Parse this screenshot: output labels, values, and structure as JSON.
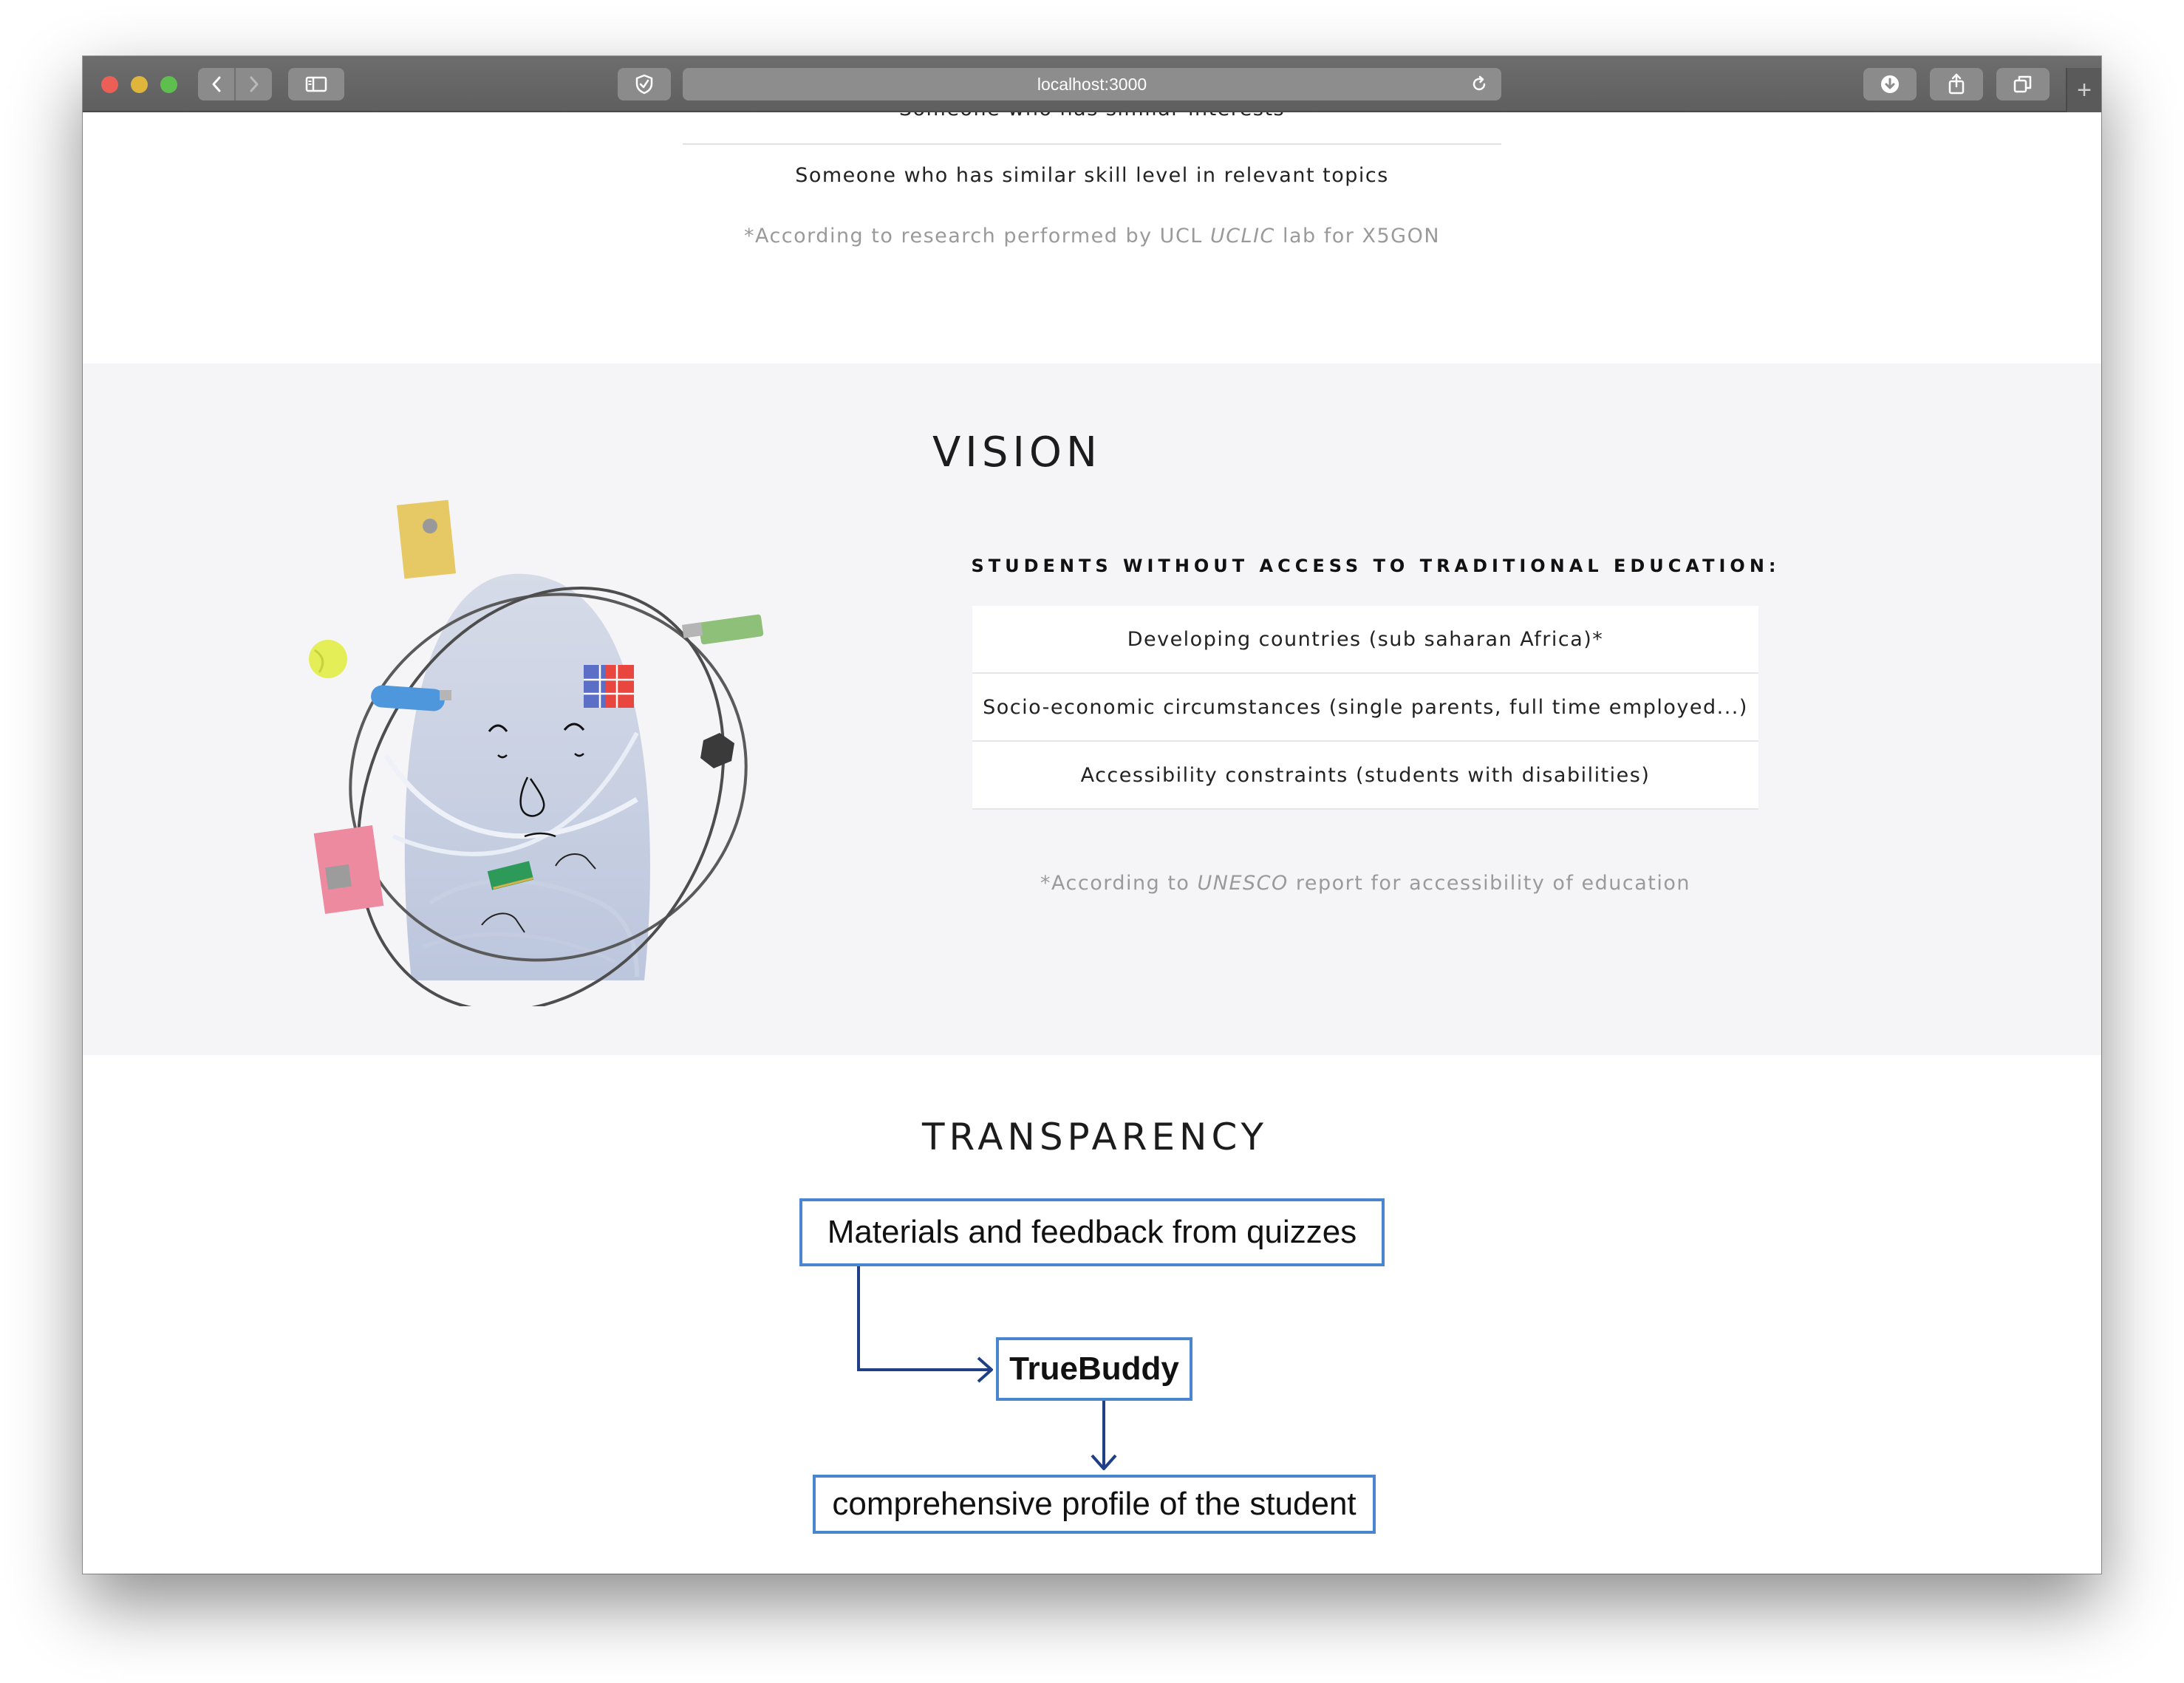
{
  "browser": {
    "address": "localhost:3000",
    "new_tab_label": "+"
  },
  "intro": {
    "cut_line": "Someone who has similar interests",
    "line2": "Someone who has similar skill level in relevant topics",
    "note_prefix": "*According to research performed by UCL ",
    "note_em": "UCLIC",
    "note_suffix": " lab for X5GON"
  },
  "vision": {
    "title": "VISION",
    "subhead": "STUDENTS WITHOUT ACCESS TO TRADITIONAL EDUCATION:",
    "items": [
      "Developing countries (sub saharan Africa)*",
      "Socio-economic circumstances (single parents, full time employed...)",
      "Accessibility constraints (students with disabilities)"
    ],
    "note_prefix": "*According to ",
    "note_em": "UNESCO",
    "note_suffix": " report for accessibility of education"
  },
  "transparency": {
    "title": "TRANSPARENCY",
    "box_input": "Materials and feedback from quizzes",
    "box_center": "TrueBuddy",
    "box_output": "comprehensive profile of the student",
    "box_color": "#4a86cf",
    "arrow_color": "#1f3f86"
  }
}
